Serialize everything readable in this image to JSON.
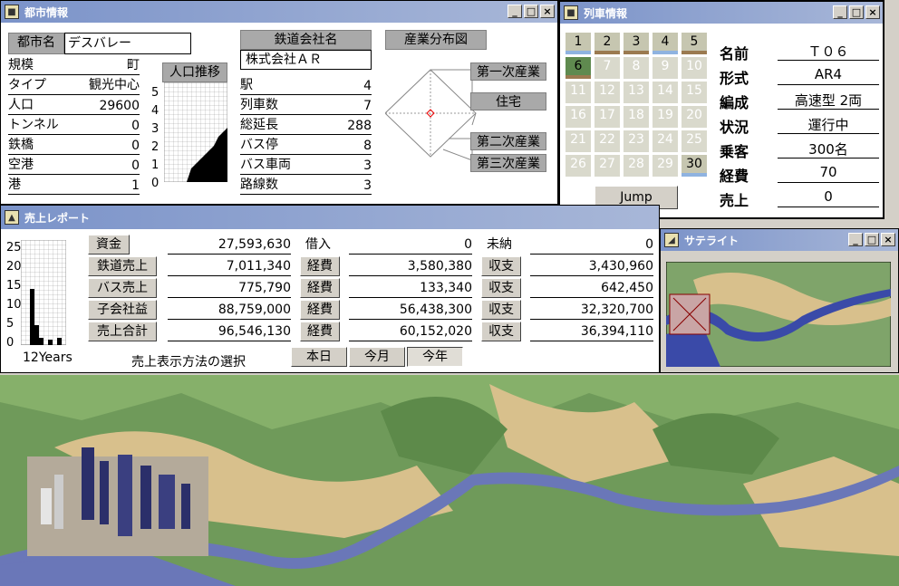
{
  "city": {
    "title": "都市情報",
    "name_label": "都市名",
    "name_value": "デスバレー",
    "stats": [
      {
        "label": "規模",
        "value": "町"
      },
      {
        "label": "タイプ",
        "value": "観光中心"
      },
      {
        "label": "人口",
        "value": "29600"
      },
      {
        "label": "トンネル",
        "value": "0"
      },
      {
        "label": "鉄橋",
        "value": "0"
      },
      {
        "label": "空港",
        "value": "0"
      },
      {
        "label": "港",
        "value": "1"
      }
    ],
    "pop_trend_label": "人口推移",
    "pop_axis": [
      "5",
      "4",
      "3",
      "2",
      "1",
      "0"
    ],
    "company_label": "鉄道会社名",
    "company_value": "株式会社ＡＲ",
    "company_stats": [
      {
        "label": "駅",
        "value": "4"
      },
      {
        "label": "列車数",
        "value": "7"
      },
      {
        "label": "総延長",
        "value": "288"
      },
      {
        "label": "バス停",
        "value": "8"
      },
      {
        "label": "バス車両",
        "value": "3"
      },
      {
        "label": "路線数",
        "value": "3"
      }
    ],
    "industry_label": "産業分布図",
    "industry_items": [
      "第一次産業",
      "住宅",
      "第二次産業",
      "第三次産業"
    ]
  },
  "train": {
    "title": "列車情報",
    "slots": [
      "1",
      "2",
      "3",
      "4",
      "5",
      "6",
      "7",
      "8",
      "9",
      "10",
      "11",
      "12",
      "13",
      "14",
      "15",
      "16",
      "17",
      "18",
      "19",
      "20",
      "21",
      "22",
      "23",
      "24",
      "25",
      "26",
      "27",
      "28",
      "29",
      "30"
    ],
    "jump": "Jump",
    "fields": [
      {
        "label": "名前",
        "value": "Ｔ０６"
      },
      {
        "label": "形式",
        "value": "AR4"
      },
      {
        "label": "編成",
        "value": "高速型 2両"
      },
      {
        "label": "状況",
        "value": "運行中"
      },
      {
        "label": "乗客",
        "value": "300名"
      },
      {
        "label": "経費",
        "value": "70"
      },
      {
        "label": "売上",
        "value": "0"
      }
    ]
  },
  "sales": {
    "title": "売上レポート",
    "axis": [
      "25",
      "20",
      "15",
      "10",
      "5",
      "0"
    ],
    "years_label": "12Years",
    "rows": [
      {
        "label": "資金",
        "amount": "27,593,630",
        "mid_label": "借入",
        "mid": "0",
        "right_label": "未納",
        "right": "0"
      },
      {
        "label": "鉄道売上",
        "amount": "7,011,340",
        "mid_label": "経費",
        "mid": "3,580,380",
        "right_label": "収支",
        "right": "3,430,960"
      },
      {
        "label": "バス売上",
        "amount": "775,790",
        "mid_label": "経費",
        "mid": "133,340",
        "right_label": "収支",
        "right": "642,450"
      },
      {
        "label": "子会社益",
        "amount": "88,759,000",
        "mid_label": "経費",
        "mid": "56,438,300",
        "right_label": "収支",
        "right": "32,320,700"
      },
      {
        "label": "売上合計",
        "amount": "96,546,130",
        "mid_label": "経費",
        "mid": "60,152,020",
        "right_label": "収支",
        "right": "36,394,110"
      }
    ],
    "method_label": "売上表示方法の選択",
    "periods": [
      "本日",
      "今月",
      "今年"
    ]
  },
  "satellite": {
    "title": "サテライト"
  }
}
